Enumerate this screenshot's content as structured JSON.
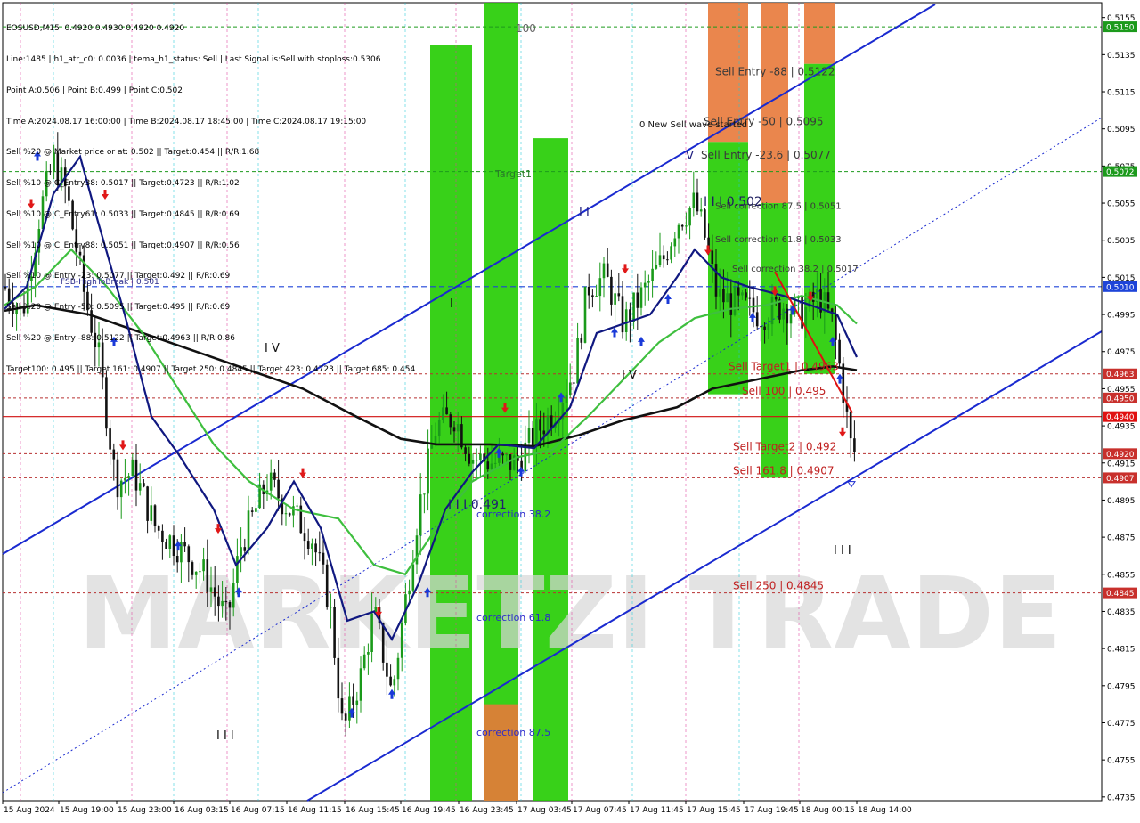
{
  "header": {
    "symbol_line": "EOSUSD,M15  0.4920 0.4930 0.4920 0.4920",
    "info_lines": [
      "Line:1485 | h1_atr_c0: 0.0036 | tema_h1_status: Sell | Last Signal is:Sell with stoploss:0.5306",
      "Point A:0.506 | Point B:0.499 | Point C:0.502",
      "Time A:2024.08.17 16:00:00 | Time B:2024.08.17 18:45:00 | Time C:2024.08.17 19:15:00",
      "Sell %20 @ Market price or at: 0.502 || Target:0.454 || R/R:1.68",
      "Sell %10 @ C_Entry38: 0.5017 || Target:0.4723 || R/R:1.02",
      "Sell %10 @ C_Entry61: 0.5033 || Target:0.4845 || R/R:0.69",
      "Sell %10 @ C_Entry88: 0.5051 || Target:0.4907 || R/R:0.56",
      "Sell %10 @ Entry -23: 0.5077 || Target:0.492 || R/R:0.69",
      "Sell %20 @ Entry -50: 0.5095 || Target:0.495 || R/R:0.69",
      "Sell %20 @ Entry -88: 0.5122 || Target:0.4963 || R/R:0.86",
      "Target100: 0.495 || Target 161: 0.4907 || Target 250: 0.4845 || Target 423: 0.4723 || Target 685: 0.454"
    ]
  },
  "chart_data": {
    "type": "candlestick",
    "symbol": "EOSUSD",
    "timeframe": "M15",
    "ylim": [
      0.4733,
      0.5163
    ],
    "y_ticks": [
      "0.5155",
      "0.5135",
      "0.5115",
      "0.5095",
      "0.5075",
      "0.5055",
      "0.5035",
      "0.5015",
      "0.4995",
      "0.4975",
      "0.4955",
      "0.4935",
      "0.4915",
      "0.4895",
      "0.4875",
      "0.4855",
      "0.4835",
      "0.4815",
      "0.4795",
      "0.4775",
      "0.4755",
      "0.4735"
    ],
    "x_ticks": [
      "15 Aug 2024",
      "15 Aug 19:00",
      "15 Aug 23:00",
      "16 Aug 03:15",
      "16 Aug 07:15",
      "16 Aug 11:15",
      "16 Aug 15:45",
      "16 Aug 19:45",
      "16 Aug 23:45",
      "17 Aug 03:45",
      "17 Aug 07:45",
      "17 Aug 11:45",
      "17 Aug 15:45",
      "17 Aug 19:45",
      "18 Aug 00:15",
      "18 Aug 14:00"
    ],
    "price_tags": [
      {
        "label": "0.5150",
        "value": 0.515,
        "color": "#1c9a1c"
      },
      {
        "label": "0.5072",
        "value": 0.5072,
        "color": "#1c9a1c"
      },
      {
        "label": "0.5010",
        "value": 0.501,
        "color": "#1e44d8"
      },
      {
        "label": "0.4963",
        "value": 0.4963,
        "color": "#c8302c"
      },
      {
        "label": "0.4950",
        "value": 0.495,
        "color": "#c8302c"
      },
      {
        "label": "0.4940",
        "value": 0.494,
        "color": "#e01010"
      },
      {
        "label": "0.4920",
        "value": 0.492,
        "color": "#c8302c"
      },
      {
        "label": "0.4907",
        "value": 0.4907,
        "color": "#c8302c"
      },
      {
        "label": "0.4845",
        "value": 0.4845,
        "color": "#c8302c"
      }
    ],
    "levels": [
      {
        "label": "Sell Entry -88 | 0.5122",
        "value": 0.5122
      },
      {
        "label": "Sell Entry -50 | 0.5095",
        "value": 0.5095
      },
      {
        "label": "Sell Entry -23.6 | 0.5077",
        "value": 0.5077
      },
      {
        "label": "Sell correction 87.5 | 0.5051",
        "value": 0.5051
      },
      {
        "label": "Sell correction 61.8 | 0.5033",
        "value": 0.5033
      },
      {
        "label": "Sell correction 38.2 | 0.5017",
        "value": 0.5017
      },
      {
        "label": "Sell Target1 | 0.4963",
        "value": 0.4963
      },
      {
        "label": "Sell 100 | 0.495",
        "value": 0.495
      },
      {
        "label": "Sell Target2 | 0.492",
        "value": 0.492
      },
      {
        "label": "Sell 161.8 | 0.4907",
        "value": 0.4907
      },
      {
        "label": "Sell  250 | 0.4845",
        "value": 0.4845
      }
    ],
    "annotations": {
      "fsb": "FSB-HighToBreak | 0.501",
      "new_wave": "0 New Sell wave started",
      "target1": "Target1",
      "hundred": "100",
      "point_c": "I I I 0.502",
      "point_b": "I I I 0.491",
      "corr_382": "correction 38.2",
      "corr_618": "correction 61.8",
      "corr_875": "correction 87.5",
      "wave_iv_a": "I V",
      "wave_iv_b": "I V",
      "wave_iii_a": "I I I",
      "wave_iii_b": "I I I",
      "wave_i": "I",
      "wave_v": "V",
      "wave_ii": "I I"
    },
    "watermark": "MARKETZI TRADE",
    "colors": {
      "bull_candle": "#1a9a1a",
      "bear_candle": "#111111",
      "zone_green": "#22cc00",
      "zone_orange": "#e8793a",
      "channel": "#1a2ad0",
      "ma_black": "#111111",
      "ma_green": "#3fbf3f",
      "ma_navy": "#101880",
      "buy_arrow": "#1a3ad8",
      "sell_arrow": "#e01818"
    }
  }
}
